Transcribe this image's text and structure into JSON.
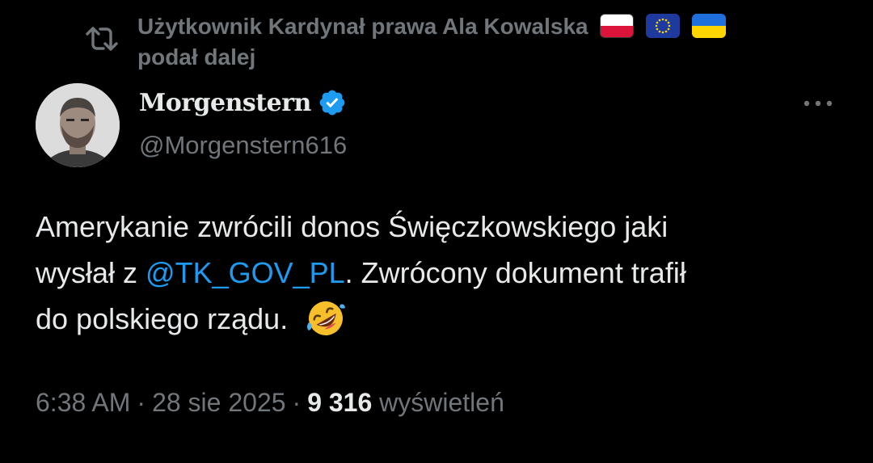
{
  "retweet": {
    "text_line1": "Użytkownik Kardynał prawa Ala Kowalska",
    "text_line2": "podał dalej",
    "flags": [
      "poland-flag",
      "eu-flag",
      "ukraine-flag"
    ]
  },
  "author": {
    "display_name": "Morgenstern",
    "handle": "@Morgenstern616",
    "verified_color": "#1d9bf0"
  },
  "tweet": {
    "text_part1": "Amerykanie zwrócili donos Święczkowskiego jaki",
    "text_part2": "wysłał z ",
    "mention": "@TK_GOV_PL",
    "text_part3": ". Zwrócony dokument trafił",
    "text_part4": "do polskiego rządu.",
    "emoji": "rolling-on-floor-laughing-emoji"
  },
  "meta": {
    "time": "6:38 AM",
    "separator": "·",
    "date": "28 sie 2025",
    "views_count": "9 316",
    "views_label": "wyświetleń"
  },
  "colors": {
    "background": "#000000",
    "primary_text": "#e7e9ea",
    "secondary_text": "#71767b",
    "accent": "#1d9bf0"
  }
}
